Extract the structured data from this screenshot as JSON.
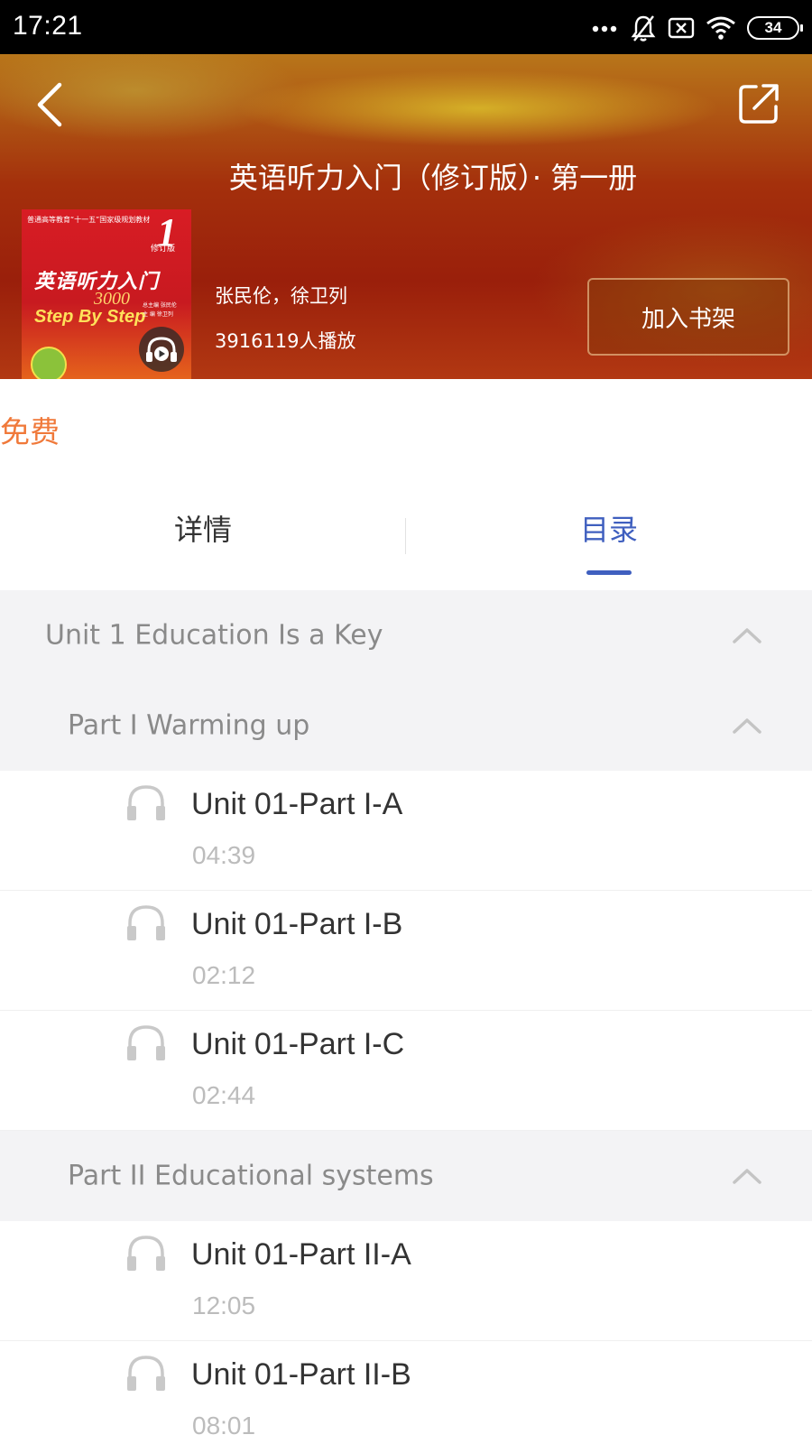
{
  "status_bar": {
    "time": "17:21",
    "battery": "34"
  },
  "header": {
    "title": "英语听力入门（修订版）· 第一册",
    "author": "张民伦，徐卫列",
    "play_count": "3916119人播放",
    "add_shelf_label": "加入书架",
    "back_icon": "back-chevron-icon",
    "share_icon": "share-icon",
    "cover": {
      "top_text": "普通高等教育“十一五”国家级规划教材",
      "volume_number": "1",
      "volume_note": "修订版",
      "title": "英语听力入门",
      "subtitle_number": "3000",
      "subtitle": "Step By Step",
      "editors": "总主编 张民伦\n主 编 徐卫列"
    }
  },
  "price_label": "免费",
  "tabs": [
    {
      "label": "详情",
      "active": false
    },
    {
      "label": "目录",
      "active": true
    }
  ],
  "toc": {
    "unit": {
      "label": "Unit 1 Education Is a Key"
    },
    "parts": [
      {
        "label": "Part I Warming up",
        "tracks": [
          {
            "title": "Unit 01-Part I-A",
            "duration": "04:39"
          },
          {
            "title": "Unit 01-Part I-B",
            "duration": "02:12"
          },
          {
            "title": "Unit 01-Part I-C",
            "duration": "02:44"
          }
        ]
      },
      {
        "label": "Part II Educational systems",
        "tracks": [
          {
            "title": "Unit 01-Part II-A",
            "duration": "12:05"
          },
          {
            "title": "Unit 01-Part II-B",
            "duration": "08:01"
          }
        ]
      }
    ]
  },
  "colors": {
    "accent_blue": "#3f5fbf",
    "price_orange": "#f0793a",
    "group_bg": "#f3f3f5"
  }
}
